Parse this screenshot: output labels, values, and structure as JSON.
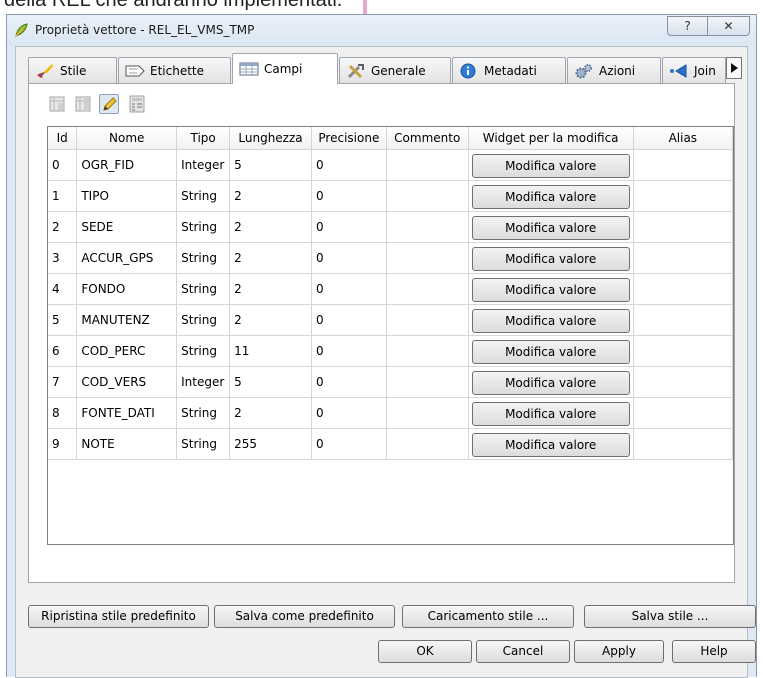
{
  "document": {
    "line_text": "della REL che andranno implementati."
  },
  "window": {
    "title": "Proprietà vettore - REL_EL_VMS_TMP",
    "help_label": "?",
    "close_label": "✕"
  },
  "tabs": [
    {
      "label": "Stile",
      "icon": "brush-icon"
    },
    {
      "label": "Etichette",
      "icon": "label-icon"
    },
    {
      "label": "Campi",
      "icon": "table-icon",
      "active": true
    },
    {
      "label": "Generale",
      "icon": "tools-icon"
    },
    {
      "label": "Metadati",
      "icon": "info-icon"
    },
    {
      "label": "Azioni",
      "icon": "gears-icon"
    },
    {
      "label": "Join",
      "icon": "join-icon"
    }
  ],
  "toolbar": [
    "new-column-icon",
    "delete-column-icon",
    "edit-mode-icon",
    "field-calculator-icon"
  ],
  "table": {
    "columns": [
      "Id",
      "Nome",
      "Tipo",
      "Lunghezza",
      "Precisione",
      "Commento",
      "Widget per la modifica",
      "Alias"
    ],
    "rows": [
      {
        "id": "0",
        "nome": "OGR_FID",
        "tipo": "Integer",
        "lunghezza": "5",
        "precisione": "0",
        "commento": "",
        "widget": "Modifica valore",
        "alias": ""
      },
      {
        "id": "1",
        "nome": "TIPO",
        "tipo": "String",
        "lunghezza": "2",
        "precisione": "0",
        "commento": "",
        "widget": "Modifica valore",
        "alias": ""
      },
      {
        "id": "2",
        "nome": "SEDE",
        "tipo": "String",
        "lunghezza": "2",
        "precisione": "0",
        "commento": "",
        "widget": "Modifica valore",
        "alias": ""
      },
      {
        "id": "3",
        "nome": "ACCUR_GPS",
        "tipo": "String",
        "lunghezza": "2",
        "precisione": "0",
        "commento": "",
        "widget": "Modifica valore",
        "alias": ""
      },
      {
        "id": "4",
        "nome": "FONDO",
        "tipo": "String",
        "lunghezza": "2",
        "precisione": "0",
        "commento": "",
        "widget": "Modifica valore",
        "alias": ""
      },
      {
        "id": "5",
        "nome": "MANUTENZ",
        "tipo": "String",
        "lunghezza": "2",
        "precisione": "0",
        "commento": "",
        "widget": "Modifica valore",
        "alias": ""
      },
      {
        "id": "6",
        "nome": "COD_PERC",
        "tipo": "String",
        "lunghezza": "11",
        "precisione": "0",
        "commento": "",
        "widget": "Modifica valore",
        "alias": ""
      },
      {
        "id": "7",
        "nome": "COD_VERS",
        "tipo": "Integer",
        "lunghezza": "5",
        "precisione": "0",
        "commento": "",
        "widget": "Modifica valore",
        "alias": ""
      },
      {
        "id": "8",
        "nome": "FONTE_DATI",
        "tipo": "String",
        "lunghezza": "2",
        "precisione": "0",
        "commento": "",
        "widget": "Modifica valore",
        "alias": ""
      },
      {
        "id": "9",
        "nome": "NOTE",
        "tipo": "String",
        "lunghezza": "255",
        "precisione": "0",
        "commento": "",
        "widget": "Modifica valore",
        "alias": ""
      }
    ]
  },
  "style_buttons": {
    "restore_default": "Ripristina stile predefinito",
    "save_as_default": "Salva come predefinito",
    "load_style": "Caricamento stile ...",
    "save_style": "Salva stile ..."
  },
  "dialog_buttons": {
    "ok": "OK",
    "cancel": "Cancel",
    "apply": "Apply",
    "help": "Help"
  }
}
